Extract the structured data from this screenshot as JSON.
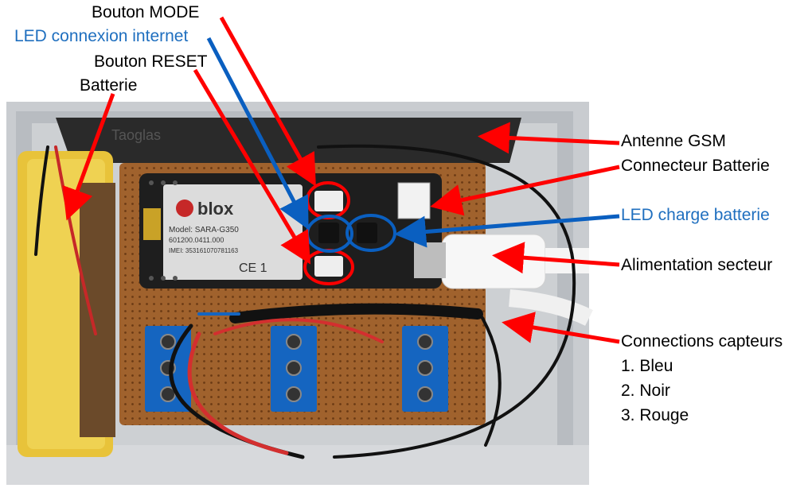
{
  "labels": {
    "bouton_mode": "Bouton MODE",
    "led_connexion": "LED connexion internet",
    "bouton_reset": "Bouton RESET",
    "batterie": "Batterie",
    "antenne": "Antenne GSM",
    "connecteur": "Connecteur Batterie",
    "led_charge": "LED charge batterie",
    "alimentation": "Alimentation secteur",
    "connections": "Connections capteurs",
    "item1": "1. Bleu",
    "item2": "2. Noir",
    "item3": "3. Rouge"
  },
  "module": {
    "brand": "blox",
    "model": "SARA-G350",
    "line1": "Model: SARA-G350",
    "line2": "601200.0411.000",
    "line3": "IMEI: 353161070781163",
    "ce": "CE 1"
  },
  "antenna_text": "Taoglas",
  "colors": {
    "red_arrow": "#ff0000",
    "blue_arrow": "#0a5fc0",
    "blue_text": "#1f6fbf",
    "pcb": "#a0622d",
    "terminal_blue": "#1565c0",
    "battery": "#e8c33a"
  }
}
